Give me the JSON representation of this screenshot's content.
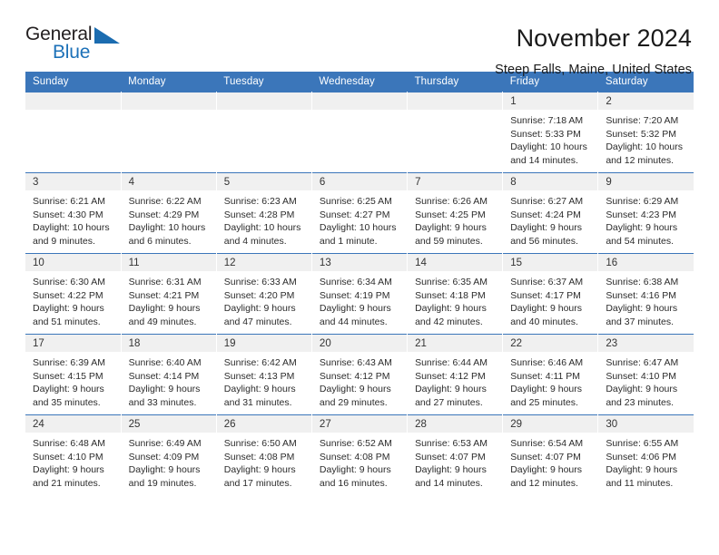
{
  "logo": {
    "word1": "General",
    "word2": "Blue",
    "triangle_color": "#1b6cb0"
  },
  "header": {
    "month_title": "November 2024",
    "location": "Steep Falls, Maine, United States"
  },
  "theme": {
    "header_row_bg": "#3b76ba",
    "day_number_bg": "#f0f0f0",
    "cell_bg": "#ffffff",
    "text": "#2b2b2b"
  },
  "calendar": {
    "weekday_headers": [
      "Sunday",
      "Monday",
      "Tuesday",
      "Wednesday",
      "Thursday",
      "Friday",
      "Saturday"
    ],
    "weeks": [
      [
        {
          "day": "",
          "empty": true
        },
        {
          "day": "",
          "empty": true
        },
        {
          "day": "",
          "empty": true
        },
        {
          "day": "",
          "empty": true
        },
        {
          "day": "",
          "empty": true
        },
        {
          "day": "1",
          "sunrise": "Sunrise: 7:18 AM",
          "sunset": "Sunset: 5:33 PM",
          "daylight1": "Daylight: 10 hours",
          "daylight2": "and 14 minutes."
        },
        {
          "day": "2",
          "sunrise": "Sunrise: 7:20 AM",
          "sunset": "Sunset: 5:32 PM",
          "daylight1": "Daylight: 10 hours",
          "daylight2": "and 12 minutes."
        }
      ],
      [
        {
          "day": "3",
          "sunrise": "Sunrise: 6:21 AM",
          "sunset": "Sunset: 4:30 PM",
          "daylight1": "Daylight: 10 hours",
          "daylight2": "and 9 minutes."
        },
        {
          "day": "4",
          "sunrise": "Sunrise: 6:22 AM",
          "sunset": "Sunset: 4:29 PM",
          "daylight1": "Daylight: 10 hours",
          "daylight2": "and 6 minutes."
        },
        {
          "day": "5",
          "sunrise": "Sunrise: 6:23 AM",
          "sunset": "Sunset: 4:28 PM",
          "daylight1": "Daylight: 10 hours",
          "daylight2": "and 4 minutes."
        },
        {
          "day": "6",
          "sunrise": "Sunrise: 6:25 AM",
          "sunset": "Sunset: 4:27 PM",
          "daylight1": "Daylight: 10 hours",
          "daylight2": "and 1 minute."
        },
        {
          "day": "7",
          "sunrise": "Sunrise: 6:26 AM",
          "sunset": "Sunset: 4:25 PM",
          "daylight1": "Daylight: 9 hours",
          "daylight2": "and 59 minutes."
        },
        {
          "day": "8",
          "sunrise": "Sunrise: 6:27 AM",
          "sunset": "Sunset: 4:24 PM",
          "daylight1": "Daylight: 9 hours",
          "daylight2": "and 56 minutes."
        },
        {
          "day": "9",
          "sunrise": "Sunrise: 6:29 AM",
          "sunset": "Sunset: 4:23 PM",
          "daylight1": "Daylight: 9 hours",
          "daylight2": "and 54 minutes."
        }
      ],
      [
        {
          "day": "10",
          "sunrise": "Sunrise: 6:30 AM",
          "sunset": "Sunset: 4:22 PM",
          "daylight1": "Daylight: 9 hours",
          "daylight2": "and 51 minutes."
        },
        {
          "day": "11",
          "sunrise": "Sunrise: 6:31 AM",
          "sunset": "Sunset: 4:21 PM",
          "daylight1": "Daylight: 9 hours",
          "daylight2": "and 49 minutes."
        },
        {
          "day": "12",
          "sunrise": "Sunrise: 6:33 AM",
          "sunset": "Sunset: 4:20 PM",
          "daylight1": "Daylight: 9 hours",
          "daylight2": "and 47 minutes."
        },
        {
          "day": "13",
          "sunrise": "Sunrise: 6:34 AM",
          "sunset": "Sunset: 4:19 PM",
          "daylight1": "Daylight: 9 hours",
          "daylight2": "and 44 minutes."
        },
        {
          "day": "14",
          "sunrise": "Sunrise: 6:35 AM",
          "sunset": "Sunset: 4:18 PM",
          "daylight1": "Daylight: 9 hours",
          "daylight2": "and 42 minutes."
        },
        {
          "day": "15",
          "sunrise": "Sunrise: 6:37 AM",
          "sunset": "Sunset: 4:17 PM",
          "daylight1": "Daylight: 9 hours",
          "daylight2": "and 40 minutes."
        },
        {
          "day": "16",
          "sunrise": "Sunrise: 6:38 AM",
          "sunset": "Sunset: 4:16 PM",
          "daylight1": "Daylight: 9 hours",
          "daylight2": "and 37 minutes."
        }
      ],
      [
        {
          "day": "17",
          "sunrise": "Sunrise: 6:39 AM",
          "sunset": "Sunset: 4:15 PM",
          "daylight1": "Daylight: 9 hours",
          "daylight2": "and 35 minutes."
        },
        {
          "day": "18",
          "sunrise": "Sunrise: 6:40 AM",
          "sunset": "Sunset: 4:14 PM",
          "daylight1": "Daylight: 9 hours",
          "daylight2": "and 33 minutes."
        },
        {
          "day": "19",
          "sunrise": "Sunrise: 6:42 AM",
          "sunset": "Sunset: 4:13 PM",
          "daylight1": "Daylight: 9 hours",
          "daylight2": "and 31 minutes."
        },
        {
          "day": "20",
          "sunrise": "Sunrise: 6:43 AM",
          "sunset": "Sunset: 4:12 PM",
          "daylight1": "Daylight: 9 hours",
          "daylight2": "and 29 minutes."
        },
        {
          "day": "21",
          "sunrise": "Sunrise: 6:44 AM",
          "sunset": "Sunset: 4:12 PM",
          "daylight1": "Daylight: 9 hours",
          "daylight2": "and 27 minutes."
        },
        {
          "day": "22",
          "sunrise": "Sunrise: 6:46 AM",
          "sunset": "Sunset: 4:11 PM",
          "daylight1": "Daylight: 9 hours",
          "daylight2": "and 25 minutes."
        },
        {
          "day": "23",
          "sunrise": "Sunrise: 6:47 AM",
          "sunset": "Sunset: 4:10 PM",
          "daylight1": "Daylight: 9 hours",
          "daylight2": "and 23 minutes."
        }
      ],
      [
        {
          "day": "24",
          "sunrise": "Sunrise: 6:48 AM",
          "sunset": "Sunset: 4:10 PM",
          "daylight1": "Daylight: 9 hours",
          "daylight2": "and 21 minutes."
        },
        {
          "day": "25",
          "sunrise": "Sunrise: 6:49 AM",
          "sunset": "Sunset: 4:09 PM",
          "daylight1": "Daylight: 9 hours",
          "daylight2": "and 19 minutes."
        },
        {
          "day": "26",
          "sunrise": "Sunrise: 6:50 AM",
          "sunset": "Sunset: 4:08 PM",
          "daylight1": "Daylight: 9 hours",
          "daylight2": "and 17 minutes."
        },
        {
          "day": "27",
          "sunrise": "Sunrise: 6:52 AM",
          "sunset": "Sunset: 4:08 PM",
          "daylight1": "Daylight: 9 hours",
          "daylight2": "and 16 minutes."
        },
        {
          "day": "28",
          "sunrise": "Sunrise: 6:53 AM",
          "sunset": "Sunset: 4:07 PM",
          "daylight1": "Daylight: 9 hours",
          "daylight2": "and 14 minutes."
        },
        {
          "day": "29",
          "sunrise": "Sunrise: 6:54 AM",
          "sunset": "Sunset: 4:07 PM",
          "daylight1": "Daylight: 9 hours",
          "daylight2": "and 12 minutes."
        },
        {
          "day": "30",
          "sunrise": "Sunrise: 6:55 AM",
          "sunset": "Sunset: 4:06 PM",
          "daylight1": "Daylight: 9 hours",
          "daylight2": "and 11 minutes."
        }
      ]
    ]
  }
}
